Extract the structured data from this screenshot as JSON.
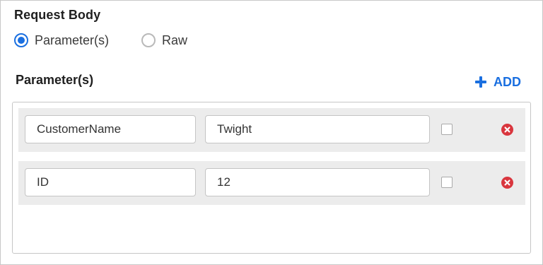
{
  "request_body": {
    "title": "Request Body",
    "options": [
      {
        "label": "Parameter(s)",
        "checked": true
      },
      {
        "label": "Raw",
        "checked": false
      }
    ]
  },
  "parameters": {
    "title": "Parameter(s)",
    "add_label": "ADD",
    "rows": [
      {
        "key": "CustomerName",
        "value": "Twight",
        "checked": false
      },
      {
        "key": "ID",
        "value": "12",
        "checked": false
      }
    ]
  },
  "colors": {
    "accent": "#1a6fe0",
    "remove": "#d9363e",
    "row_bg": "#ececec"
  },
  "icons": {
    "add": "plus-icon",
    "remove": "remove-circle-icon"
  }
}
